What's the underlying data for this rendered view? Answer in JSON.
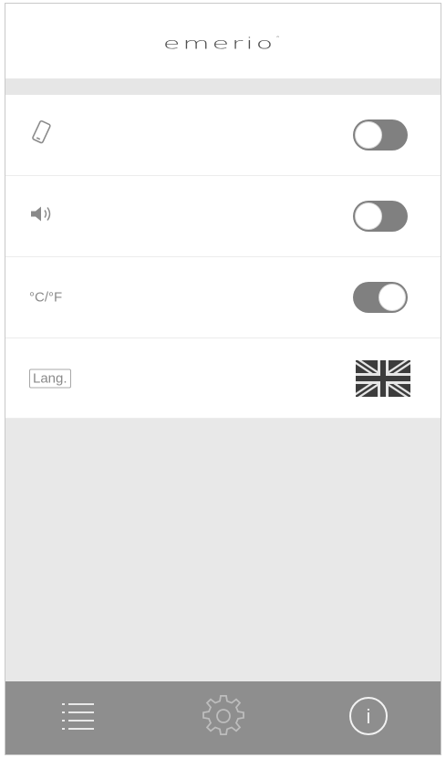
{
  "header": {
    "brand": "emerio",
    "brand_mark": "°"
  },
  "settings": [
    {
      "icon": "phone-vibrate-icon",
      "state": "off"
    },
    {
      "icon": "speaker-icon",
      "state": "off"
    },
    {
      "label": "°C/°F",
      "state": "on"
    },
    {
      "label": "Lang.",
      "value_icon": "uk-flag-icon"
    }
  ],
  "tabbar": {
    "items": [
      {
        "icon": "list-icon"
      },
      {
        "icon": "gear-icon"
      },
      {
        "icon": "info-icon",
        "glyph": "i"
      }
    ]
  },
  "colors": {
    "toggle_track": "#808080",
    "tabbar": "#8e8e8e",
    "background": "#e8e8e8"
  }
}
